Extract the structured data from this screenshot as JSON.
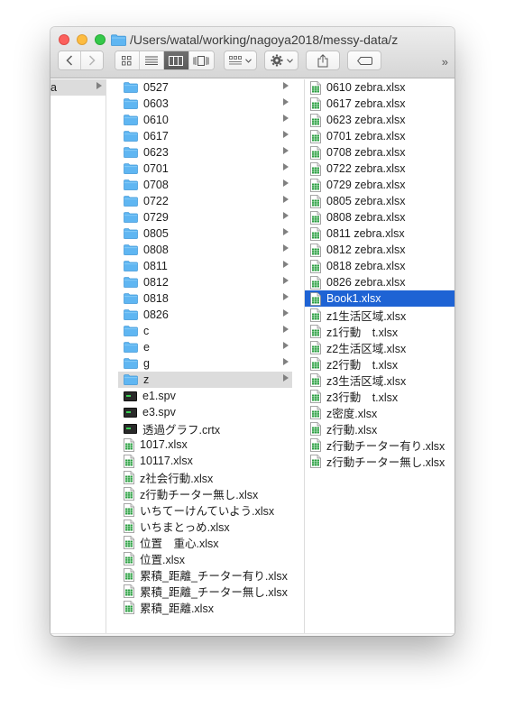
{
  "window": {
    "title": "/Users/watal/working/nagoya2018/messy-data/z"
  },
  "toolbar": {
    "back_icon": "chevron-left-icon",
    "forward_icon": "chevron-right-icon",
    "views": [
      "icon-view",
      "list-view",
      "column-view",
      "cover-flow-view"
    ],
    "active_view": "column-view",
    "arrange_icon": "arrange-icon",
    "action_icon": "gear-icon",
    "share_icon": "share-icon",
    "tags_icon": "tag-icon",
    "overflow_label": "»"
  },
  "columns": {
    "col1": {
      "items": [
        {
          "name": "a",
          "type": "folder",
          "selected": "grey"
        }
      ]
    },
    "col2": {
      "items": [
        {
          "name": "0527",
          "type": "folder"
        },
        {
          "name": "0603",
          "type": "folder"
        },
        {
          "name": "0610",
          "type": "folder"
        },
        {
          "name": "0617",
          "type": "folder"
        },
        {
          "name": "0623",
          "type": "folder"
        },
        {
          "name": "0701",
          "type": "folder"
        },
        {
          "name": "0708",
          "type": "folder"
        },
        {
          "name": "0722",
          "type": "folder"
        },
        {
          "name": "0729",
          "type": "folder"
        },
        {
          "name": "0805",
          "type": "folder"
        },
        {
          "name": "0808",
          "type": "folder"
        },
        {
          "name": "0811",
          "type": "folder"
        },
        {
          "name": "0812",
          "type": "folder"
        },
        {
          "name": "0818",
          "type": "folder"
        },
        {
          "name": "0826",
          "type": "folder"
        },
        {
          "name": "c",
          "type": "folder"
        },
        {
          "name": "e",
          "type": "folder"
        },
        {
          "name": "g",
          "type": "folder"
        },
        {
          "name": "z",
          "type": "folder",
          "selected": "grey"
        },
        {
          "name": "e1.spv",
          "type": "spv"
        },
        {
          "name": "e3.spv",
          "type": "spv"
        },
        {
          "name": "透過グラフ.crtx",
          "type": "spv"
        },
        {
          "name": "1017.xlsx",
          "type": "xlsx"
        },
        {
          "name": "10117.xlsx",
          "type": "xlsx"
        },
        {
          "name": "z社会行動.xlsx",
          "type": "xlsx"
        },
        {
          "name": "z行動チーター無し.xlsx",
          "type": "xlsx"
        },
        {
          "name": "いちてーけんていよう.xlsx",
          "type": "xlsx"
        },
        {
          "name": "いちまとっめ.xlsx",
          "type": "xlsx"
        },
        {
          "name": "位置　重心.xlsx",
          "type": "xlsx"
        },
        {
          "name": "位置.xlsx",
          "type": "xlsx"
        },
        {
          "name": "累積_距離_チーター有り.xlsx",
          "type": "xlsx"
        },
        {
          "name": "累積_距離_チーター無し.xlsx",
          "type": "xlsx"
        },
        {
          "name": "累積_距離.xlsx",
          "type": "xlsx"
        }
      ]
    },
    "col3": {
      "items": [
        {
          "name": "0610 zebra.xlsx",
          "type": "xlsx"
        },
        {
          "name": "0617 zebra.xlsx",
          "type": "xlsx"
        },
        {
          "name": "0623 zebra.xlsx",
          "type": "xlsx"
        },
        {
          "name": "0701 zebra.xlsx",
          "type": "xlsx"
        },
        {
          "name": "0708 zebra.xlsx",
          "type": "xlsx"
        },
        {
          "name": "0722 zebra.xlsx",
          "type": "xlsx"
        },
        {
          "name": "0729 zebra.xlsx",
          "type": "xlsx"
        },
        {
          "name": "0805 zebra.xlsx",
          "type": "xlsx"
        },
        {
          "name": "0808 zebra.xlsx",
          "type": "xlsx"
        },
        {
          "name": "0811 zebra.xlsx",
          "type": "xlsx"
        },
        {
          "name": "0812 zebra.xlsx",
          "type": "xlsx"
        },
        {
          "name": "0818 zebra.xlsx",
          "type": "xlsx"
        },
        {
          "name": "0826 zebra.xlsx",
          "type": "xlsx"
        },
        {
          "name": "Book1.xlsx",
          "type": "xlsx",
          "selected": "blue"
        },
        {
          "name": "z1生活区域.xlsx",
          "type": "xlsx"
        },
        {
          "name": "z1行動　t.xlsx",
          "type": "xlsx"
        },
        {
          "name": "z2生活区域.xlsx",
          "type": "xlsx"
        },
        {
          "name": "z2行動　t.xlsx",
          "type": "xlsx"
        },
        {
          "name": "z3生活区域.xlsx",
          "type": "xlsx"
        },
        {
          "name": "z3行動　t.xlsx",
          "type": "xlsx"
        },
        {
          "name": "z密度.xlsx",
          "type": "xlsx"
        },
        {
          "name": "z行動.xlsx",
          "type": "xlsx"
        },
        {
          "name": "z行動チーター有り.xlsx",
          "type": "xlsx"
        },
        {
          "name": "z行動チーター無し.xlsx",
          "type": "xlsx"
        }
      ]
    }
  },
  "colors": {
    "selection_blue": "#1e63d4",
    "selection_grey": "#dcdcdc",
    "folder_blue": "#5fb6f2"
  }
}
